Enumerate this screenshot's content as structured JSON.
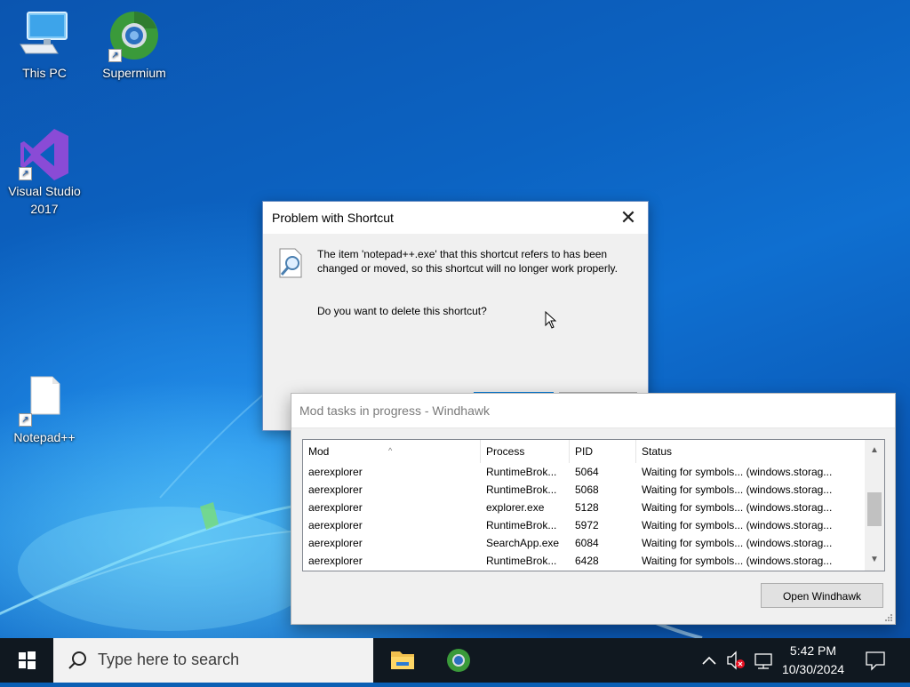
{
  "desktop": {
    "icons": [
      {
        "label": "This PC"
      },
      {
        "label": "Supermium"
      },
      {
        "label": "Visual Studio 2017"
      },
      {
        "label": "Notepad++"
      }
    ]
  },
  "dialog": {
    "title": "Problem with Shortcut",
    "message": "The item 'notepad++.exe' that this shortcut refers to has been changed or moved, so this shortcut will no longer work properly.",
    "question": "Do you want to delete this shortcut?"
  },
  "windhawk": {
    "title": "Mod tasks in progress - Windhawk",
    "columns": [
      "Mod",
      "Process",
      "PID",
      "Status"
    ],
    "rows": [
      [
        "aerexplorer",
        "RuntimeBrok...",
        "5064",
        "Waiting for symbols... (windows.storag..."
      ],
      [
        "aerexplorer",
        "RuntimeBrok...",
        "5068",
        "Waiting for symbols... (windows.storag..."
      ],
      [
        "aerexplorer",
        "explorer.exe",
        "5128",
        "Waiting for symbols... (windows.storag..."
      ],
      [
        "aerexplorer",
        "RuntimeBrok...",
        "5972",
        "Waiting for symbols... (windows.storag..."
      ],
      [
        "aerexplorer",
        "SearchApp.exe",
        "6084",
        "Waiting for symbols... (windows.storag..."
      ],
      [
        "aerexplorer",
        "RuntimeBrok...",
        "6428",
        "Waiting for symbols... (windows.storag..."
      ]
    ],
    "open_button": "Open Windhawk"
  },
  "taskbar": {
    "search_placeholder": "Type here to search",
    "time": "5:42 PM",
    "date": "10/30/2024"
  },
  "colors": {
    "accent": "#0078d7",
    "taskbar_bg": "#101820",
    "desktop_blue": "#0c63c2"
  }
}
